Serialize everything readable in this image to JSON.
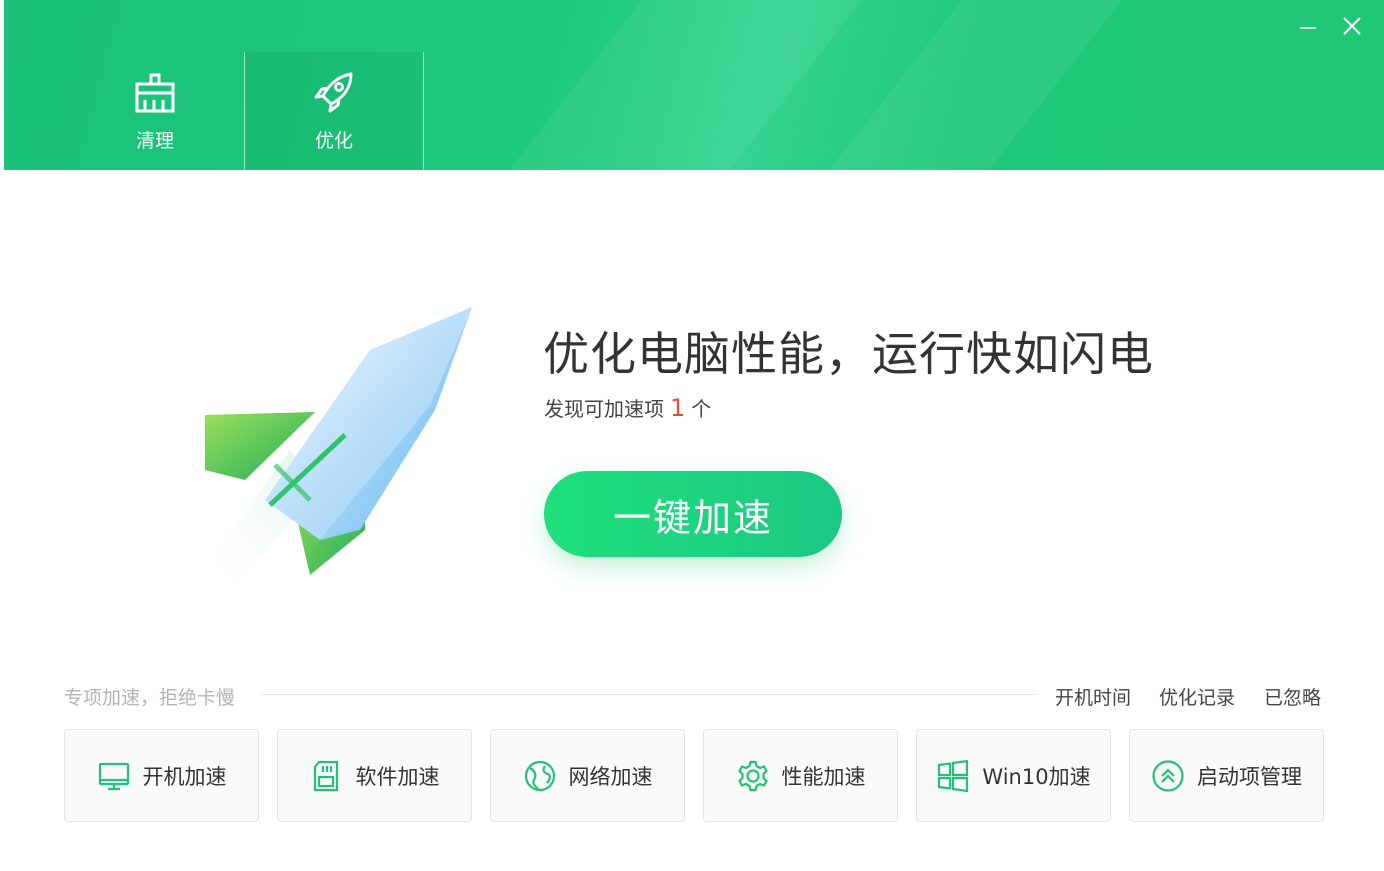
{
  "window": {
    "minimize_icon": "minimize-icon",
    "close_icon": "close-icon"
  },
  "nav": {
    "tabs": [
      {
        "label": "清理",
        "icon": "broom-icon",
        "active": false
      },
      {
        "label": "优化",
        "icon": "rocket-icon",
        "active": true
      }
    ]
  },
  "hero": {
    "title": "优化电脑性能，运行快如闪电",
    "subtitle_prefix": "发现可加速项",
    "count": "1",
    "subtitle_suffix": "个",
    "button_label": "一键加速"
  },
  "section": {
    "label": "专项加速，拒绝卡慢",
    "links": [
      "开机时间",
      "优化记录",
      "已忽略"
    ]
  },
  "cards": [
    {
      "label": "开机加速",
      "icon": "monitor-icon"
    },
    {
      "label": "软件加速",
      "icon": "sd-card-icon"
    },
    {
      "label": "网络加速",
      "icon": "globe-icon"
    },
    {
      "label": "性能加速",
      "icon": "gear-icon"
    },
    {
      "label": "Win10加速",
      "icon": "windows-icon"
    },
    {
      "label": "启动项管理",
      "icon": "startup-chevron-icon"
    }
  ],
  "colors": {
    "brand_green": "#1ec97c",
    "accent_red": "#e64a3b",
    "icon_green": "#22c17a"
  }
}
